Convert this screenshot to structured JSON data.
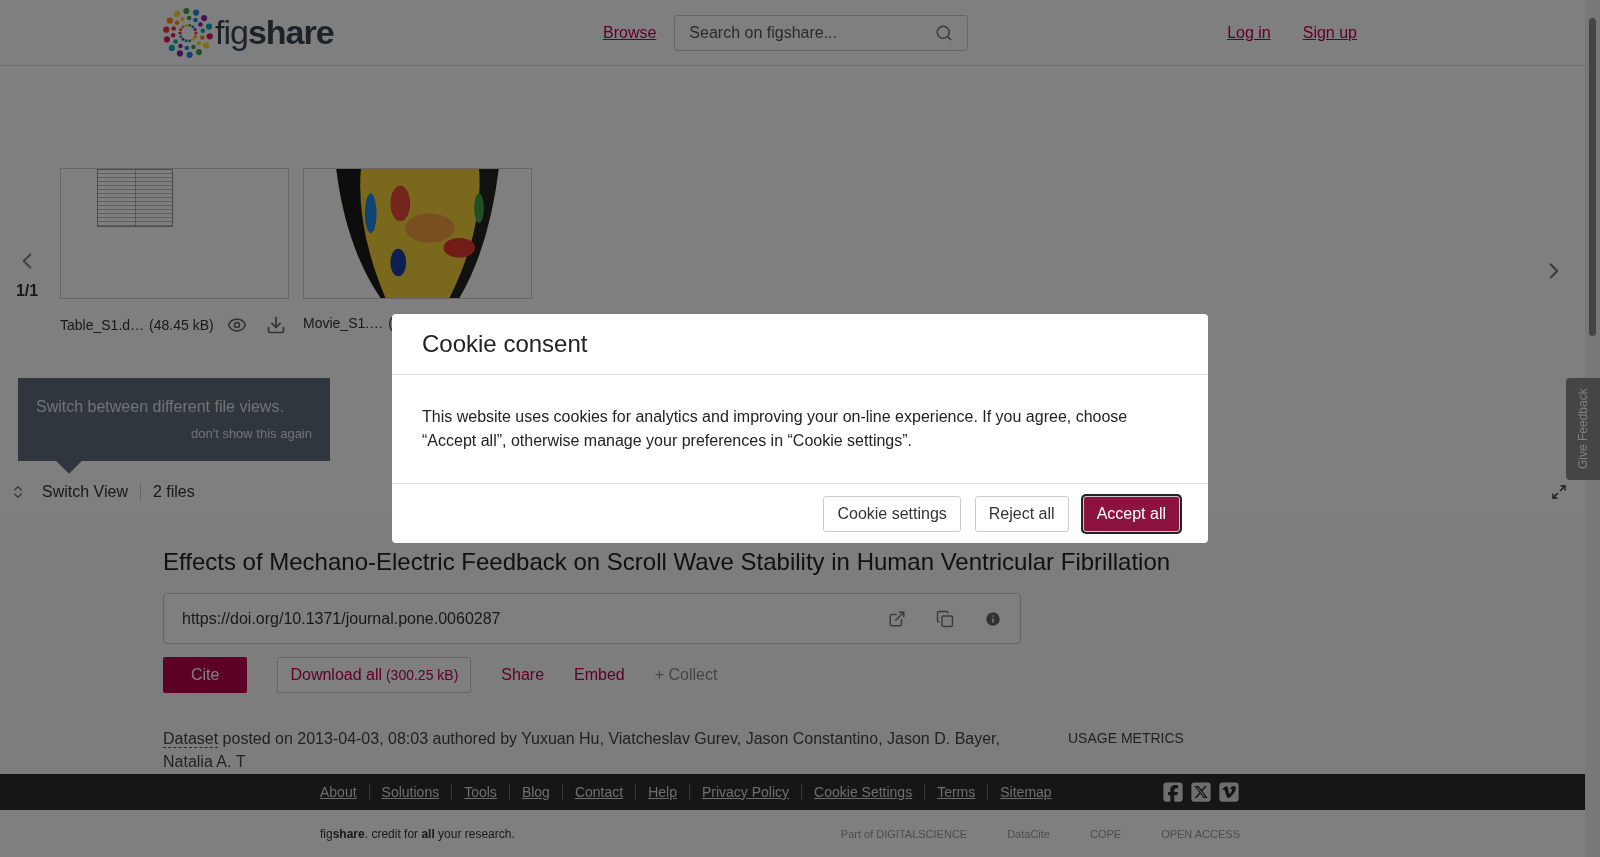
{
  "header": {
    "logo": "fig**share**",
    "nav": [
      {
        "label": "Browse"
      }
    ],
    "search": {
      "placeholder": "Search on figshare..."
    },
    "auth": [
      {
        "label": "Log in"
      },
      {
        "label": "Sign up"
      }
    ]
  },
  "viewer": {
    "pager": "1/1",
    "files": [
      {
        "name": "Table_S1.d…",
        "size": "(48.45 kB)",
        "kind": "table",
        "actions_visible": true
      },
      {
        "name": "Movie_S1.…",
        "size": "(",
        "kind": "movie",
        "actions_visible": false
      }
    ],
    "tooltip": {
      "text": "Switch between different file views.",
      "dismiss": "don't show this again"
    },
    "switch_view": "Switch View",
    "file_count": "2 files"
  },
  "feedback_tab": "Give Feedback",
  "article": {
    "title": "Effects of Mechano-Electric Feedback on Scroll Wave Stability in Human Ventricular Fibrillation",
    "doi": "https://doi.org/10.1371/journal.pone.0060287",
    "actions": [
      {
        "kind": "primary",
        "label": "Cite"
      },
      {
        "kind": "outline",
        "label": "Download all",
        "note": "(300.25 kB)"
      },
      {
        "kind": "link",
        "label": "Share"
      },
      {
        "kind": "link",
        "label": "Embed"
      },
      {
        "kind": "muted",
        "label": "+ Collect"
      }
    ],
    "type": "Dataset",
    "meta": "posted on 2013-04-03, 08:03 authored by Yuxuan Hu, Viatcheslav Gurev, Jason Constantino, Jason D. Bayer, Natalia A. T",
    "usage": "USAGE METRICS"
  },
  "footer": {
    "links": [
      "About",
      "Solutions",
      "Tools",
      "Blog",
      "Contact",
      "Help",
      "Privacy Policy",
      "Cookie Settings",
      "Terms",
      "Sitemap"
    ],
    "tagline": "fig**share**. credit for **all** your research.",
    "partners": [
      "Part of DIGITALSCIENCE",
      "DataCite",
      "COPE",
      "OPEN ACCESS"
    ]
  },
  "cookie_modal": {
    "title": "Cookie consent",
    "text": "This website uses cookies for analytics and improving your on-line experience. If you agree, choose “Accept all”, otherwise manage your preferences in “Cookie settings”.",
    "buttons": [
      {
        "label": "Cookie settings",
        "kind": "secondary",
        "selected": false
      },
      {
        "label": "Reject all",
        "kind": "secondary",
        "selected": false
      },
      {
        "label": "Accept all",
        "kind": "primary",
        "selected": true
      }
    ]
  }
}
